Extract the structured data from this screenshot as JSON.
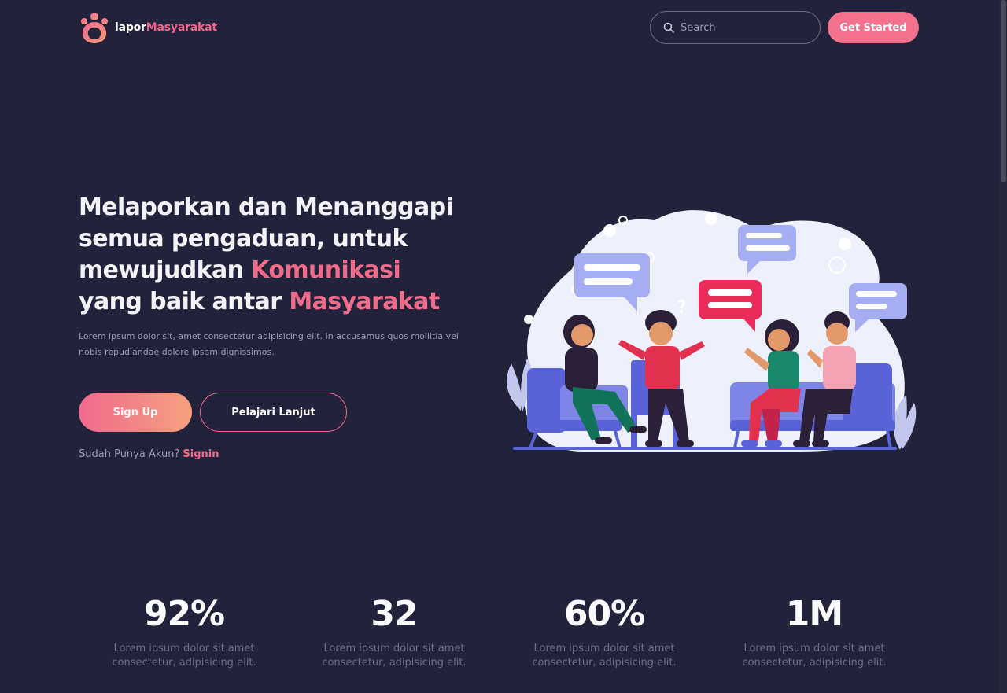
{
  "brand": {
    "name_part1": "lapor",
    "name_part2": "Masyarakat"
  },
  "header": {
    "search_placeholder": "Search",
    "cta_label": "Get Started"
  },
  "hero": {
    "title_line1": "Melaporkan dan Menanggapi",
    "title_line2": "semua pengaduan, untuk",
    "title_line3_prefix": "mewujudkan ",
    "title_line3_highlight": "Komunikasi",
    "title_line4_prefix": "yang baik antar ",
    "title_line4_highlight": "Masyarakat",
    "description": "Lorem ipsum dolor sit, amet consectetur adipisicing elit. In accusamus quos mollitia vel nobis repudiandae dolore ipsam dignissimos.",
    "signup_label": "Sign Up",
    "learn_label": "Pelajari Lanjut",
    "account_text": "Sudah Punya Akun?",
    "signin_label": "Signin"
  },
  "stats": [
    {
      "value": "92%",
      "description": "Lorem ipsum dolor sit amet consectetur, adipisicing elit."
    },
    {
      "value": "32",
      "description": "Lorem ipsum dolor sit amet consectetur, adipisicing elit."
    },
    {
      "value": "60%",
      "description": "Lorem ipsum dolor sit amet consectetur, adipisicing elit."
    },
    {
      "value": "1M",
      "description": "Lorem ipsum dolor sit amet consectetur, adipisicing elit."
    }
  ],
  "colors": {
    "background": "#22223a",
    "accent": "#f06a8a",
    "gradient_end": "#f4a07c",
    "muted_text": "#9a9ab2"
  },
  "icons": {
    "logo": "people-group-logo",
    "search": "search-icon"
  }
}
